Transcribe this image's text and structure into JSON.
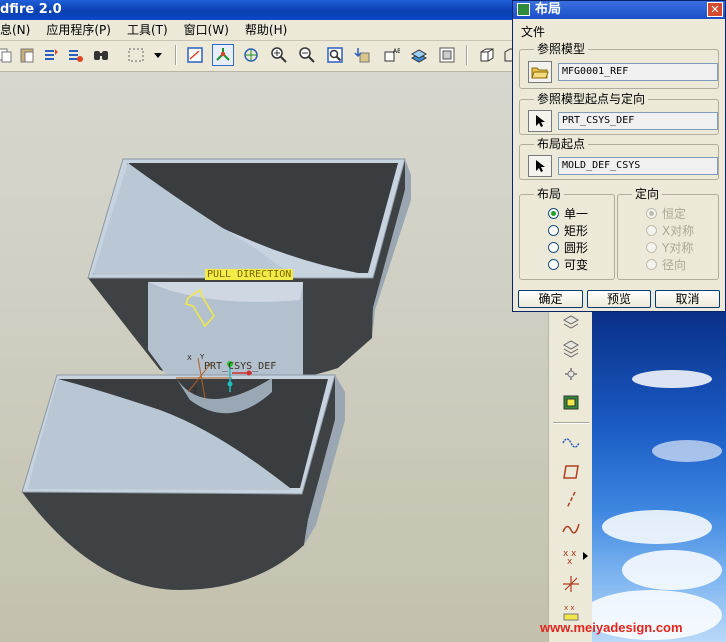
{
  "window": {
    "title": "dfire 2.0"
  },
  "menubar": {
    "items": [
      "息(N)",
      "应用程序(P)",
      "工具(T)",
      "窗口(W)",
      "帮助(H)"
    ]
  },
  "graphics": {
    "labels": {
      "pull_direction": "PULL DIRECTION",
      "csys": "PRT_CSYS_DEF",
      "axis_x": "X",
      "axis_y": "Y",
      "axis_z": "Z"
    }
  },
  "dialog": {
    "title": "布局",
    "menu_file": "文件",
    "ref_model": {
      "label": "参照模型",
      "value": "MFG0001_REF"
    },
    "ref_origin": {
      "label": "参照模型起点与定向",
      "value": "PRT_CSYS_DEF"
    },
    "layout_origin": {
      "label": "布局起点",
      "value": "MOLD_DEF_CSYS"
    },
    "layout": {
      "label": "布局",
      "options": [
        "单一",
        "矩形",
        "圆形",
        "可变"
      ],
      "selected": "单一"
    },
    "orientation": {
      "label": "定向",
      "options": [
        "恒定",
        "X对称",
        "Y对称",
        "径向"
      ],
      "selected": "恒定"
    },
    "buttons": {
      "ok": "确定",
      "preview": "预览",
      "cancel": "取消"
    }
  },
  "watermark": "www.meiyadesign.com",
  "colors": {
    "title_blue": "#0a3fb0",
    "model_light": "#c7d3df",
    "model_dark": "#3f4245",
    "highlight_yellow": "#f0e84a"
  }
}
